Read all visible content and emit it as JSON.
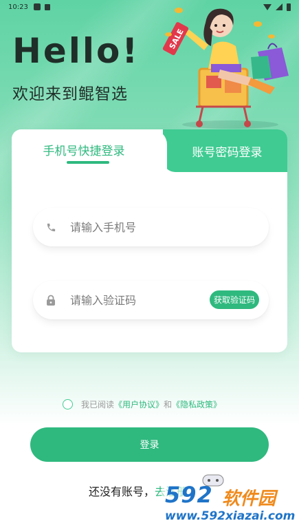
{
  "status_bar": {
    "time": "10:23"
  },
  "hero": {
    "title": "Hello!",
    "subtitle": "欢迎来到鲲智选",
    "sale_tag": "SALE"
  },
  "tabs": [
    {
      "label": "手机号快捷登录",
      "active": true
    },
    {
      "label": "账号密码登录",
      "active": false
    }
  ],
  "form": {
    "phone_placeholder": "请输入手机号",
    "code_placeholder": "请输入验证码",
    "get_code_label": "获取验证码"
  },
  "agreement": {
    "prefix": "我已阅读",
    "user_agreement": "《用户协议》",
    "and": "和",
    "privacy_policy": "《隐私政策》",
    "checked": false
  },
  "login_button": "登录",
  "register": {
    "prompt": "还没有账号，",
    "link": "去注册"
  },
  "watermark": {
    "brand_number": "592",
    "brand_name": "软件园",
    "url": "www.592xiazai.com"
  },
  "colors": {
    "accent": "#2fb97f",
    "tab_inactive": "#3fcb92",
    "watermark_blue": "#1f74c8",
    "watermark_orange": "#f08a1c"
  }
}
